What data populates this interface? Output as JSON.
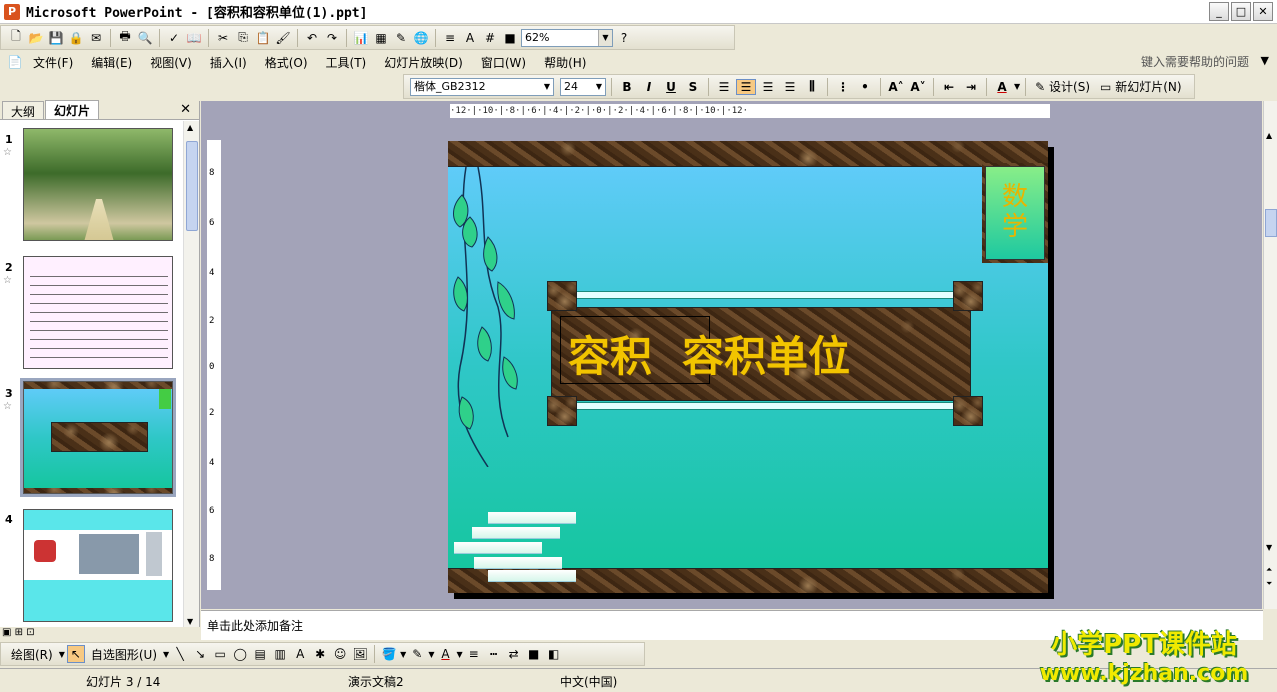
{
  "window": {
    "title": "Microsoft PowerPoint - [容积和容积单位(1).ppt]"
  },
  "toolbar": {
    "zoom": "62%"
  },
  "menu": [
    {
      "label": "文件(F)"
    },
    {
      "label": "编辑(E)"
    },
    {
      "label": "视图(V)"
    },
    {
      "label": "插入(I)"
    },
    {
      "label": "格式(O)"
    },
    {
      "label": "工具(T)"
    },
    {
      "label": "幻灯片放映(D)"
    },
    {
      "label": "窗口(W)"
    },
    {
      "label": "帮助(H)"
    }
  ],
  "help": {
    "placeholder": "键入需要帮助的问题"
  },
  "format": {
    "font": "楷体_GB2312",
    "size": "24",
    "design": "设计(S)",
    "new_slide": "新幻灯片(N)"
  },
  "pane": {
    "tab_outline": "大纲",
    "tab_slides": "幻灯片"
  },
  "thumbnails": [
    {
      "num": "1"
    },
    {
      "num": "2"
    },
    {
      "num": "3"
    },
    {
      "num": "4"
    }
  ],
  "ruler": {
    "horizontal": "·12·|·10·|·8·|·6·|·4·|·2·|·0·|·2·|·4·|·6·|·8·|·10·|·12·",
    "vertical": [
      "8",
      "6",
      "4",
      "2",
      "0",
      "2",
      "4",
      "6",
      "8"
    ]
  },
  "slide": {
    "title_left": "容积",
    "title_right": "容积单位",
    "subject": [
      "数",
      "学"
    ]
  },
  "notes": {
    "placeholder": "单击此处添加备注"
  },
  "drawing": {
    "draw": "绘图(R)",
    "autoshapes": "自选图形(U)"
  },
  "status": {
    "slide_pos": "幻灯片 3 / 14",
    "template": "演示文稿2",
    "language": "中文(中国)"
  },
  "watermark": {
    "line1": "小学PPT课件站",
    "line2": "www.kjzhan.com"
  }
}
